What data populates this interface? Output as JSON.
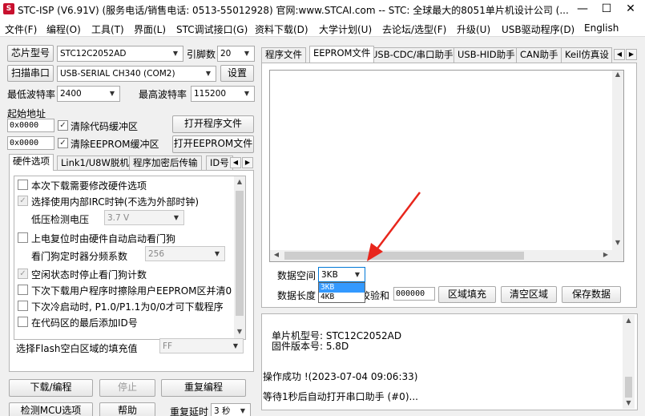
{
  "window": {
    "title": "STC-ISP (V6.91V) (服务电话/销售电话: 0513-55012928) 官网:www.STCAI.com  -- STC: 全球最大的8051单片机设计公司 (...",
    "icon_label": "S",
    "minimize": "—",
    "maximize": "☐",
    "close": "✕"
  },
  "menu": [
    "文件(F)",
    "编程(O)",
    "工具(T)",
    "界面(L)",
    "STC调试接口(G)",
    "资料下载(D)",
    "大学计划(U)",
    "去论坛/选型(F)",
    "升级(U)",
    "USB驱动程序(D)",
    "English"
  ],
  "left": {
    "chip_model_label": "芯片型号",
    "chip_model_value": "STC12C2052AD",
    "pin_count_label": "引脚数",
    "pin_count_value": "20",
    "scan_port_label": "扫描串口",
    "port_value": "USB-SERIAL CH340 (COM2)",
    "settings_label": "设置",
    "min_baud_label": "最低波特率",
    "min_baud_value": "2400",
    "max_baud_label": "最高波特率",
    "max_baud_value": "115200",
    "start_addr_label": "起始地址",
    "code_addr": "0x0000",
    "clear_code_label": "清除代码缓冲区",
    "open_prog_label": "打开程序文件",
    "eeprom_addr": "0x0000",
    "clear_eeprom_label": "清除EEPROM缓冲区",
    "open_eeprom_label": "打开EEPROM文件",
    "tabs": [
      "硬件选项",
      "Link1/U8W脱机",
      "程序加密后传输",
      "ID号"
    ],
    "options": [
      {
        "label": "本次下载需要修改硬件选项",
        "checked": false,
        "disabled": false
      },
      {
        "label": "选择使用内部IRC时钟(不选为外部时钟)",
        "checked": true,
        "disabled": true
      },
      {
        "label": "上电复位时由硬件自动启动看门狗",
        "checked": false,
        "disabled": false
      },
      {
        "label": "空闲状态时停止看门狗计数",
        "checked": true,
        "disabled": true
      },
      {
        "label": "下次下载用户程序时擦除用户EEPROM区并清0",
        "checked": false,
        "disabled": false
      },
      {
        "label": "下次冷启动时, P1.0/P1.1为0/0才可下载程序",
        "checked": false,
        "disabled": false
      },
      {
        "label": "在代码区的最后添加ID号",
        "checked": false,
        "disabled": false
      }
    ],
    "low_voltage_label": "低压检测电压",
    "low_voltage_value": "3.7 V",
    "wdt_div_label": "看门狗定时器分频系数",
    "wdt_div_value": "256",
    "fill_label": "选择Flash空白区域的填充值",
    "fill_value": "FF",
    "download_label": "下载/编程",
    "stop_label": "停止",
    "reprogram_label": "重复编程",
    "detect_label": "检测MCU选项",
    "help_label": "帮助",
    "repeat_delay_label": "重复延时",
    "repeat_delay_value": "3 秒"
  },
  "right": {
    "tabs": [
      "程序文件",
      "EEPROM文件",
      "USB-CDC/串口助手",
      "USB-HID助手",
      "CAN助手",
      "Keil仿真设"
    ],
    "data_space_label": "数据空间",
    "data_space_value": "3KB",
    "dropdown_options": [
      "3KB",
      "4KB"
    ],
    "data_length_label": "数据长度",
    "checksum_label": "校验和",
    "checksum_value": "000000",
    "fill_area_label": "区域填充",
    "clear_area_label": "清空区域",
    "save_data_label": "保存数据",
    "chip_info_line1": "单片机型号:  STC12C2052AD",
    "chip_info_line2": "固件版本号:  5.8D",
    "log_line1": "操作成功 !(2023-07-04 09:06:33)",
    "log_line2": "等待1秒后自动打开串口助手 (#0)..."
  },
  "colors": {
    "arrow": "#e8261c",
    "selection": "#3399ff",
    "focus_border": "#0078d7"
  }
}
